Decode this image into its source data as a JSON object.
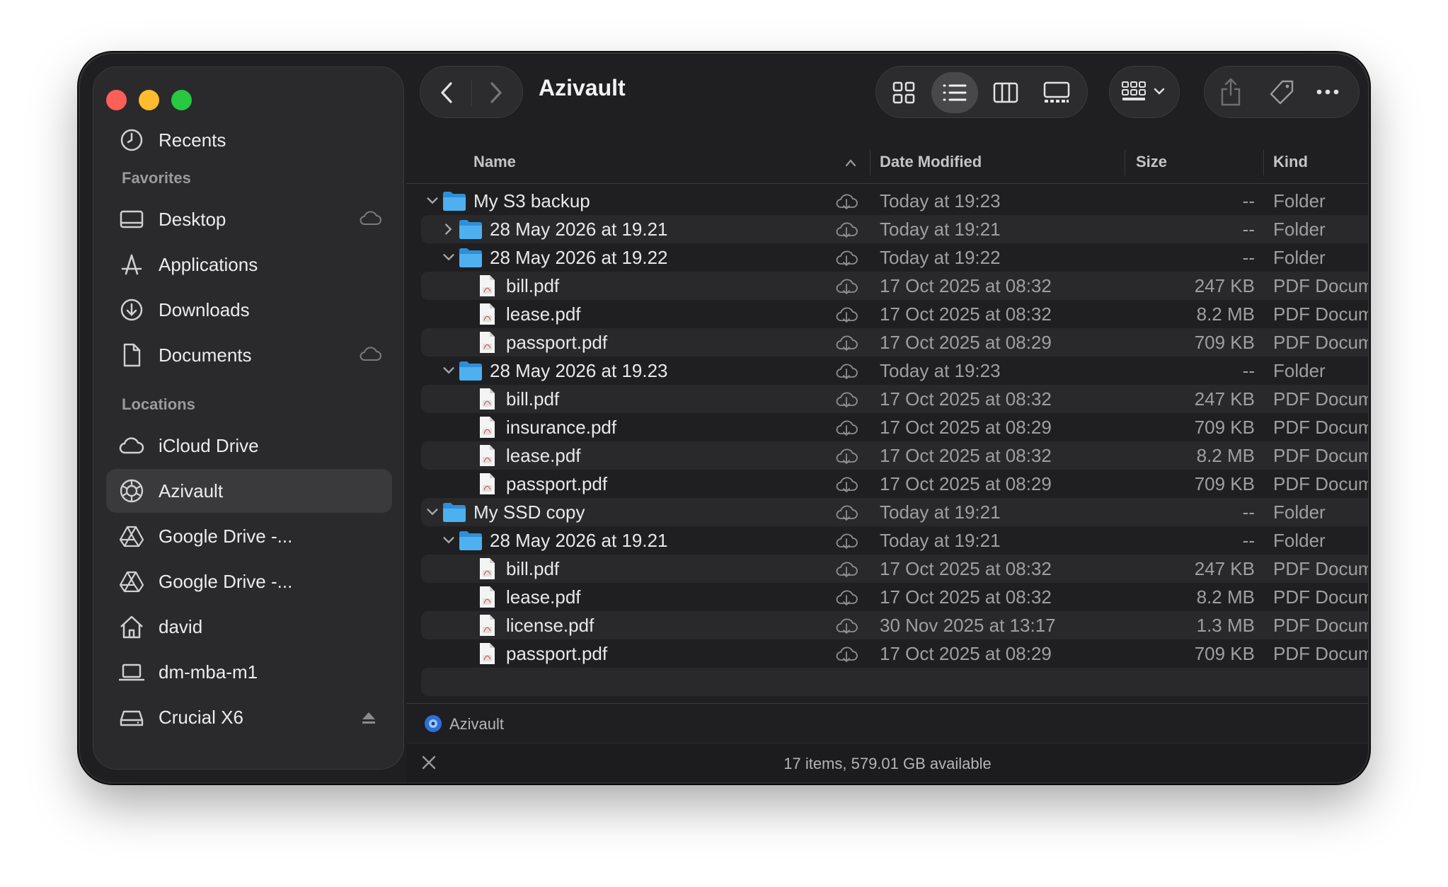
{
  "window": {
    "title": "Azivault",
    "traffic_colors": {
      "close": "#fe5f57",
      "minimize": "#febc2e",
      "zoom": "#28c840"
    }
  },
  "sidebar": {
    "recents": "Recents",
    "favorites_heading": "Favorites",
    "favorites": [
      {
        "label": "Desktop",
        "icon": "desktop-icon",
        "cloud": true
      },
      {
        "label": "Applications",
        "icon": "applications-icon",
        "cloud": false
      },
      {
        "label": "Downloads",
        "icon": "downloads-icon",
        "cloud": false
      },
      {
        "label": "Documents",
        "icon": "documents-icon",
        "cloud": true
      }
    ],
    "locations_heading": "Locations",
    "locations": [
      {
        "label": "iCloud Drive",
        "icon": "icloud-icon"
      },
      {
        "label": "Azivault",
        "icon": "azivault-icon",
        "selected": true
      },
      {
        "label": "Google Drive -...",
        "icon": "google-drive-icon"
      },
      {
        "label": "Google Drive -...",
        "icon": "google-drive-icon"
      },
      {
        "label": "david",
        "icon": "home-icon"
      },
      {
        "label": "dm-mba-m1",
        "icon": "laptop-icon"
      },
      {
        "label": "Crucial X6",
        "icon": "external-drive-icon",
        "eject": true
      }
    ]
  },
  "columns": {
    "name": "Name",
    "date": "Date Modified",
    "size": "Size",
    "kind": "Kind"
  },
  "rows": [
    {
      "level": 0,
      "type": "folder",
      "disclosure": "open",
      "name": "My S3 backup",
      "date": "Today at 19:23",
      "size": "--",
      "kind": "Folder"
    },
    {
      "level": 1,
      "type": "folder",
      "disclosure": "closed",
      "name": "28 May 2026 at 19.21",
      "date": "Today at 19:21",
      "size": "--",
      "kind": "Folder"
    },
    {
      "level": 1,
      "type": "folder",
      "disclosure": "open",
      "name": "28 May 2026 at 19.22",
      "date": "Today at 19:22",
      "size": "--",
      "kind": "Folder"
    },
    {
      "level": 2,
      "type": "file",
      "name": "bill.pdf",
      "date": "17 Oct 2025 at 08:32",
      "size": "247 KB",
      "kind": "PDF Document"
    },
    {
      "level": 2,
      "type": "file",
      "name": "lease.pdf",
      "date": "17 Oct 2025 at 08:32",
      "size": "8.2 MB",
      "kind": "PDF Document"
    },
    {
      "level": 2,
      "type": "file",
      "name": "passport.pdf",
      "date": "17 Oct 2025 at 08:29",
      "size": "709 KB",
      "kind": "PDF Document"
    },
    {
      "level": 1,
      "type": "folder",
      "disclosure": "open",
      "name": "28 May 2026 at 19.23",
      "date": "Today at 19:23",
      "size": "--",
      "kind": "Folder"
    },
    {
      "level": 2,
      "type": "file",
      "name": "bill.pdf",
      "date": "17 Oct 2025 at 08:32",
      "size": "247 KB",
      "kind": "PDF Document"
    },
    {
      "level": 2,
      "type": "file",
      "name": "insurance.pdf",
      "date": "17 Oct 2025 at 08:29",
      "size": "709 KB",
      "kind": "PDF Document"
    },
    {
      "level": 2,
      "type": "file",
      "name": "lease.pdf",
      "date": "17 Oct 2025 at 08:32",
      "size": "8.2 MB",
      "kind": "PDF Document"
    },
    {
      "level": 2,
      "type": "file",
      "name": "passport.pdf",
      "date": "17 Oct 2025 at 08:29",
      "size": "709 KB",
      "kind": "PDF Document"
    },
    {
      "level": 0,
      "type": "folder",
      "disclosure": "open",
      "name": "My SSD copy",
      "date": "Today at 19:21",
      "size": "--",
      "kind": "Folder"
    },
    {
      "level": 1,
      "type": "folder",
      "disclosure": "open",
      "name": "28 May 2026 at 19.21",
      "date": "Today at 19:21",
      "size": "--",
      "kind": "Folder"
    },
    {
      "level": 2,
      "type": "file",
      "name": "bill.pdf",
      "date": "17 Oct 2025 at 08:32",
      "size": "247 KB",
      "kind": "PDF Document"
    },
    {
      "level": 2,
      "type": "file",
      "name": "lease.pdf",
      "date": "17 Oct 2025 at 08:32",
      "size": "8.2 MB",
      "kind": "PDF Document"
    },
    {
      "level": 2,
      "type": "file",
      "name": "license.pdf",
      "date": "30 Nov 2025 at 13:17",
      "size": "1.3 MB",
      "kind": "PDF Document"
    },
    {
      "level": 2,
      "type": "file",
      "name": "passport.pdf",
      "date": "17 Oct 2025 at 08:29",
      "size": "709 KB",
      "kind": "PDF Document"
    }
  ],
  "pathbar": {
    "location": "Azivault"
  },
  "status": {
    "text": "17 items, 579.01 GB available"
  },
  "colors": {
    "folder": "#3ea3e6",
    "selected_sidebar": "#3a3a3d",
    "window_bg": "#1f1f21"
  }
}
